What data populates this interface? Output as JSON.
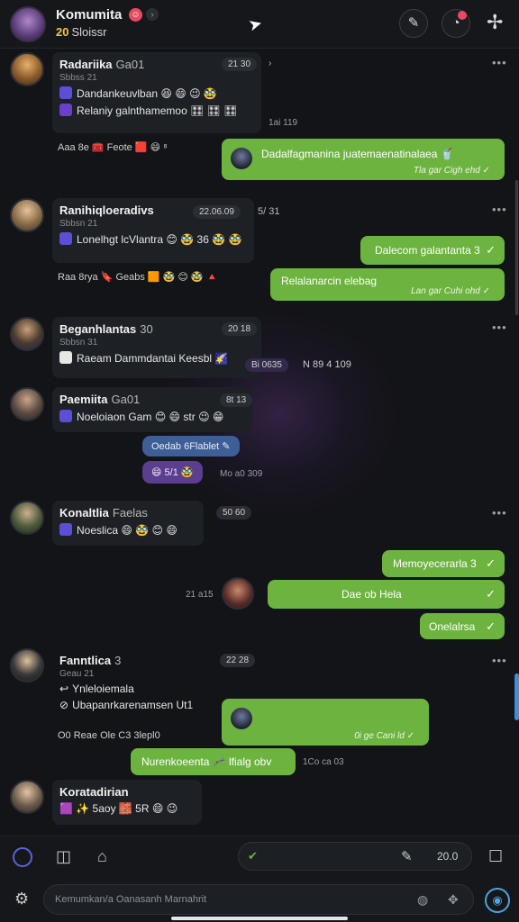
{
  "header": {
    "title": "Komumita",
    "badge_icon": "emoji-face",
    "number": "20",
    "subtitle": "Sloissr",
    "colors": {
      "accent": "#6db33f",
      "badge": "#e84a5f",
      "link": "#4ea3e0"
    }
  },
  "messages": {
    "m1": {
      "name": "Radariika",
      "meta": "Ga01",
      "sub": "Sbbss 21",
      "time": "21 30",
      "line1": "Dandankeuvlban 😆 😄 😉 🥸",
      "line2": "Relaniy galnthamemoo 🎛 🎛 🎛",
      "side_time": "1ai 119",
      "reactions": "Aaa 8e 🧰 Feote 🟥 😄 ⁸"
    },
    "g1": {
      "text": "Dadalfagmanina juatemaenatinalaea 🥤",
      "stamp": "Tla gar Cigh ehd ✓"
    },
    "m2": {
      "name": "Ranihiqloeradivs",
      "meta": "",
      "sub": "Sbbsn 21",
      "time": "22.06.09",
      "extra": "5/ 31",
      "line1": "Lonelhgt lcVlantra 😊 🥸 36 🥸 🥸",
      "reactions": "Raa 8rya 🔖 Geabs 🟧 🥸 😊 🥸 🔺"
    },
    "g2": {
      "text": "Dalecom galantanta 3"
    },
    "g3": {
      "text": "Relalanarcin elebag",
      "stamp": "Lan gar Cuhi ohd ✓"
    },
    "m3": {
      "name": "Beganhlantas",
      "meta": "30",
      "sub": "Sbbsn 31",
      "time": "20 18",
      "line1": "Raeam Dammdantai Keesbl 🌠",
      "pill": "Bi 0635",
      "side": "N 89 4 109"
    },
    "m4": {
      "name": "Paemiita",
      "meta": "Ga01",
      "time": "8t 13",
      "line1": "Noeloiaon Gam 😊 😄 str 😉 😁",
      "blue": "Oedab 6Flablet ✎",
      "purple": "😄 5/1 🥸",
      "stamp": "Mo a0 309"
    },
    "m5": {
      "name": "Konaltlia",
      "meta": "Faelas",
      "time": "50 60",
      "line1": "Noeslica 😄 🥸 😊 😄"
    },
    "g4": {
      "text": "Memoyecerarla 3"
    },
    "g5": {
      "text": "Dae ob Hela",
      "side_time": "21 a15"
    },
    "g6": {
      "text": "Onelalrsa"
    },
    "m6": {
      "name": "Fanntlica",
      "meta": "3",
      "sub": "Geau 21",
      "time": "22 28",
      "line1": "Ynleloiemala",
      "line2": "Ubapanrkarenamsen Ut1",
      "reactions": "O0 Reae Ole C3 3lepl0"
    },
    "g7": {
      "stamp": "0i ge Cani ld ✓"
    },
    "g8": {
      "text": "Nurenkoeenta 🦟 lfialg obv",
      "stamp": "1Co ca 03"
    },
    "m7": {
      "name": "Koratadirian",
      "line1": "🟪 ✨ 5aoy 🧱 5R 😄 😉"
    }
  },
  "bottom": {
    "counter": "20.0",
    "placeholder": "Kemumkan/a Oanasanh Marnahrit"
  }
}
